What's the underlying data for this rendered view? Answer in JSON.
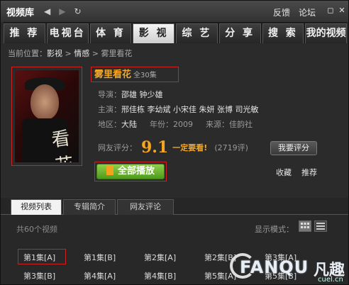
{
  "titlebar": {
    "app_title": "视频库",
    "feedback": "反馈",
    "forum": "论坛",
    "back_icon": "◀",
    "forward_icon": "▶",
    "refresh_icon": "↻",
    "max_icon": "◻",
    "close_icon": "✕"
  },
  "nav": {
    "tabs": [
      "推 荐",
      "电视台",
      "体 育",
      "影 视",
      "综 艺",
      "分 享",
      "搜 索",
      "我的视频"
    ],
    "active_index": 3
  },
  "breadcrumb": {
    "prefix": "当前位置：",
    "level1": "影视",
    "level2": "情感",
    "current": "雾里看花",
    "sep": " > "
  },
  "show": {
    "title": "雾里看花",
    "episodes": "全30集",
    "directors_label": "导演：",
    "directors": "邵雄  钟少雄",
    "cast_label": "主演：",
    "cast": "邢佳栋  李幼斌  小宋佳  朱妍  张博  司光敏",
    "region_label": "地区：",
    "region": "大陆",
    "year_label": "年份：",
    "year": "2009",
    "source_label": "来源：",
    "source": "佳韵社",
    "rating_label": "网友评分：",
    "rating": "9.1",
    "rating_note": "一定要看!",
    "rating_count": "(2719评)",
    "poster_script": "看花"
  },
  "actions": {
    "rate": "我要评分",
    "play_all": "全部播放",
    "favorite": "收藏",
    "recommend": "推荐"
  },
  "subtabs": [
    "视频列表",
    "专辑简介",
    "网友评论"
  ],
  "list": {
    "count": "共60个视频",
    "mode_label": "显示模式：",
    "row1": [
      "第1集[A]",
      "第1集[B]",
      "第2集[A]",
      "第2集[B]",
      "第3集[A]"
    ],
    "row2": [
      "第3集[B]",
      "第4集[A]",
      "第4集[B]",
      "第5集[A]",
      "第5集[B]"
    ]
  },
  "watermark": {
    "word": "FANQU",
    "cn": "凡趣",
    "url": "cuel.cn"
  },
  "colors": {
    "accent": "#f5a623",
    "highlight_border": "#cc2222",
    "play_green": "#6bb52e"
  }
}
